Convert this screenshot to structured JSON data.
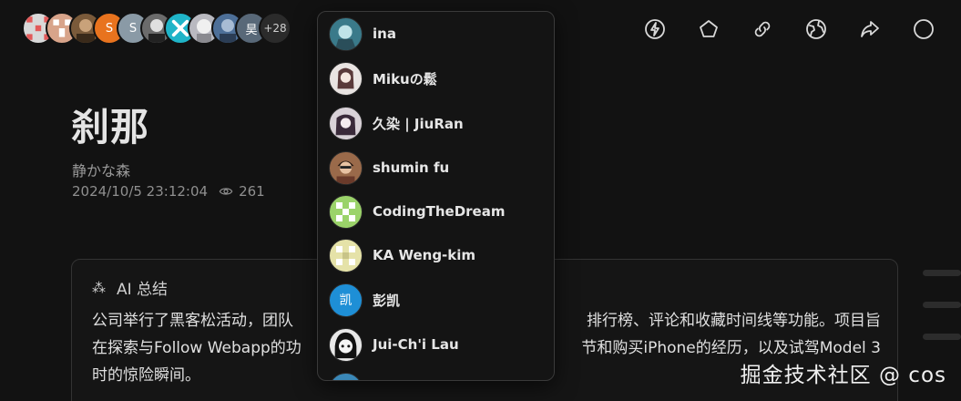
{
  "colors": {
    "background": "#121212",
    "dropdown_bg": "#141414",
    "card_border": "#333333"
  },
  "avatars": [
    {
      "icon": "pixel-pattern-avatar",
      "color": "#d9d9d9"
    },
    {
      "icon": "pixel-pattern-avatar",
      "color": "#d8a48a"
    },
    {
      "icon": "photo-avatar",
      "color": "#7a5a3a"
    },
    {
      "icon": "letter-avatar",
      "text": "S",
      "color": "#e8731e"
    },
    {
      "icon": "letter-avatar",
      "text": "S",
      "color": "#8a9aa6"
    },
    {
      "icon": "photo-avatar",
      "color": "#6b6b6b"
    },
    {
      "icon": "logo-avatar",
      "color": "#1fb4c8"
    },
    {
      "icon": "photo-avatar",
      "color": "#b9b9c0"
    },
    {
      "icon": "photo-avatar",
      "color": "#4d6f98"
    },
    {
      "icon": "letter-avatar",
      "text": "昊",
      "color": "#586878"
    }
  ],
  "more_count": "+28",
  "toolbar": [
    "lightning-icon",
    "star-icon",
    "link-icon",
    "globe-icon",
    "share-icon",
    "circle-icon"
  ],
  "article": {
    "title": "刹那",
    "author": "静かな森",
    "date": "2024/10/5 23:12:04",
    "views": "261"
  },
  "summary": {
    "heading": "AI 总结",
    "line1": "公司举行了黑客松活动，团队",
    "line1_tail": "排行榜、评论和收藏时间线等功能。项目旨",
    "line2": "在探索与Follow Webapp的功",
    "line2_tail": "节和购买iPhone的经历，以及试驾Model 3",
    "line3": "时的惊险瞬间。"
  },
  "dropdown": {
    "items": [
      {
        "name": "ina",
        "avatar_color": "#3a7a8a"
      },
      {
        "name": "Mikuの鬆",
        "avatar_color": "#e9e4e2"
      },
      {
        "name": "久染 | JiuRan",
        "avatar_color": "#d9d2d8"
      },
      {
        "name": "shumin fu",
        "avatar_color": "#9a6a4a"
      },
      {
        "name": "CodingTheDream",
        "avatar_color": "#9bd36a"
      },
      {
        "name": "KA Weng-kim",
        "avatar_color": "#e5e2a8"
      },
      {
        "name": "彭凯",
        "avatar_text": "凯",
        "avatar_color": "#1e8fd6"
      },
      {
        "name": "Jui-Ch'i Lau",
        "avatar_color": "#e8e8e8"
      }
    ]
  },
  "watermark": "掘金技术社区 @ cos"
}
